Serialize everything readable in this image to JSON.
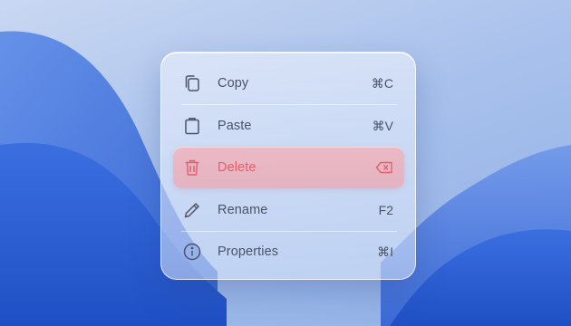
{
  "menu": {
    "items": [
      {
        "id": "copy",
        "label": "Copy",
        "shortcut": "⌘C",
        "icon": "copy-icon"
      },
      {
        "id": "paste",
        "label": "Paste",
        "shortcut": "⌘V",
        "icon": "clipboard-icon"
      },
      {
        "id": "delete",
        "label": "Delete",
        "shortcut_icon": "backspace-icon",
        "icon": "trash-icon",
        "highlighted": true
      },
      {
        "id": "rename",
        "label": "Rename",
        "shortcut": "F2",
        "icon": "pencil-icon"
      },
      {
        "id": "properties",
        "label": "Properties",
        "shortcut": "⌘I",
        "icon": "info-icon"
      }
    ]
  },
  "colors": {
    "danger": "#e4606f",
    "text": "#4a5368",
    "wallpaper_blue": "#2f63d6"
  }
}
